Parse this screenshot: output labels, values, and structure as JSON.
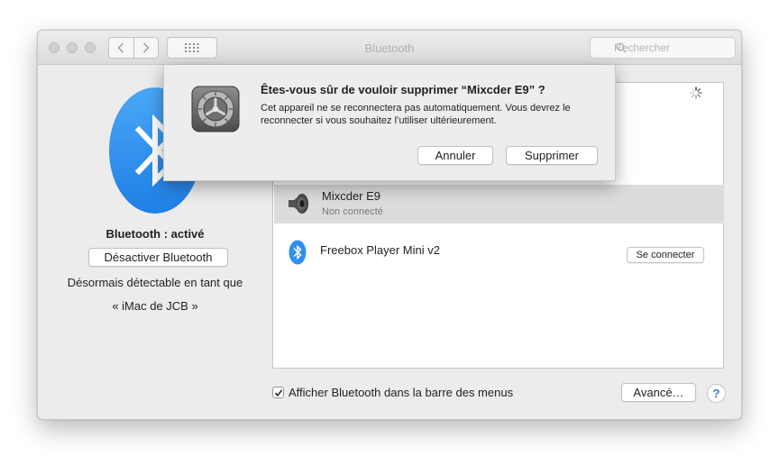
{
  "window": {
    "title": "Bluetooth"
  },
  "toolbar": {
    "back_icon": "chevron-left-icon",
    "forward_icon": "chevron-right-icon",
    "grid_icon": "grid-icon",
    "search_placeholder": "Rechercher"
  },
  "sidebar": {
    "status": "Bluetooth : activé",
    "toggle_label": "Désactiver Bluetooth",
    "discoverable_line1": "Désormais détectable en tant que",
    "discoverable_line2": "« iMac de JCB »"
  },
  "devices": [
    {
      "name": "Mixcder E9",
      "status": "Non connecté",
      "icon": "speaker-icon",
      "selected": true
    },
    {
      "name": "Freebox Player Mini v2",
      "action_label": "Se connecter",
      "icon": "bluetooth-icon"
    }
  ],
  "footer": {
    "show_in_menu_bar_label": "Afficher Bluetooth dans la barre des menus",
    "show_in_menu_bar_checked": true,
    "advanced_label": "Avancé…",
    "help_label": "?"
  },
  "dialog": {
    "title": "Êtes-vous sûr de vouloir supprimer “Mixcder E9” ?",
    "message": "Cet appareil ne se reconnectera pas automatiquement. Vous devrez le reconnecter si vous souhaitez l’utiliser ultérieurement.",
    "cancel_label": "Annuler",
    "confirm_label": "Supprimer",
    "icon": "system-preferences-gear-icon"
  },
  "colors": {
    "bluetooth_blue": "#2f8ff0",
    "selection_gray": "#dcdcdc"
  }
}
